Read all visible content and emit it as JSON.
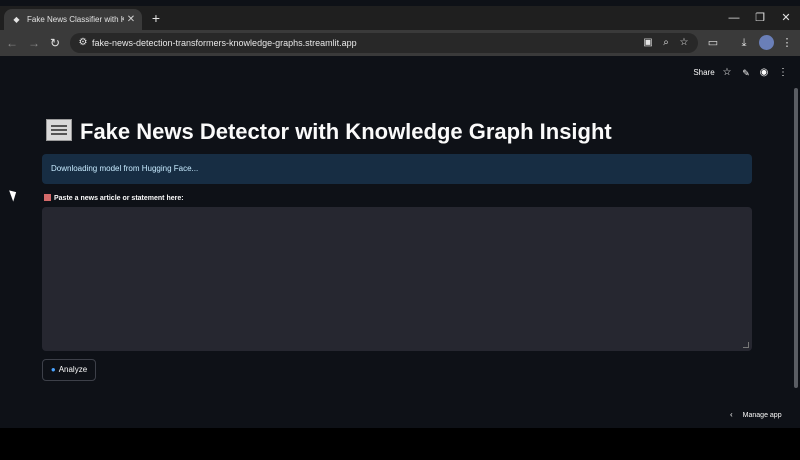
{
  "browser": {
    "tab_title": "Fake News Classifier with Knowle",
    "tab_close": "✕",
    "new_tab": "+",
    "url": "fake-news-detection-transformers-knowledge-graphs.streamlit.app",
    "window_controls": {
      "minimize": "—",
      "restore": "❐",
      "close": "✕"
    },
    "nav": {
      "back": "←",
      "forward": "→",
      "reload": "↻"
    },
    "icons": [
      "tune-icon",
      "install-app-icon",
      "zoom-icon",
      "bookmark-star-icon",
      "cast-icon",
      "download-icon",
      "profile-avatar",
      "menu-kebab-icon"
    ]
  },
  "st_header": {
    "share_label": "Share",
    "star": "☆",
    "edit": "✎",
    "github": "◉",
    "menu": "⋮"
  },
  "main": {
    "title": "Fake News Detector with Knowledge Graph Insight",
    "title_icon": "newspaper-icon",
    "info_message": "Downloading model from Hugging Face...",
    "input_label": "Paste a news article or statement here:",
    "input_value": "",
    "analyze_label": "Analyze",
    "analyze_icon": "magnifier-icon"
  },
  "footer": {
    "manage_label": "Manage app",
    "chevron": "‹"
  },
  "colors": {
    "page_bg": "#0e1117",
    "info_bg": "#172d43",
    "info_text": "#c7ebff",
    "input_bg": "#262730"
  }
}
